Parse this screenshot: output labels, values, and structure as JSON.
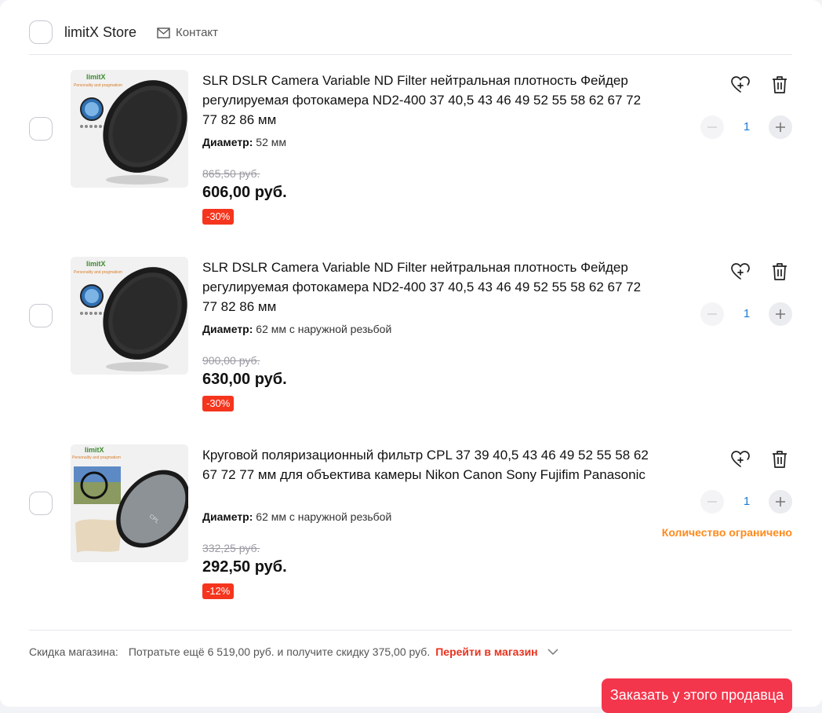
{
  "store": {
    "name": "limitX Store",
    "contact_label": "Контакт"
  },
  "items": [
    {
      "title": "SLR DSLR Camera Variable ND Filter нейтральная плотность Фейдер регулируемая фотокамера ND2-400 37 40,5 43 46 49 52 55 58 62 67 72 77 82 86 мм",
      "spec_label": "Диаметр:",
      "spec_value": "52 мм",
      "old_price": "865,50 руб.",
      "price": "606,00 руб.",
      "discount": "-30%",
      "quantity": "1",
      "limited_note": ""
    },
    {
      "title": "SLR DSLR Camera Variable ND Filter нейтральная плотность Фейдер регулируемая фотокамера ND2-400 37 40,5 43 46 49 52 55 58 62 67 72 77 82 86 мм",
      "spec_label": "Диаметр:",
      "spec_value": "62 мм с наружной резьбой",
      "old_price": "900,00 руб.",
      "price": "630,00 руб.",
      "discount": "-30%",
      "quantity": "1",
      "limited_note": ""
    },
    {
      "title": "Круговой поляризационный фильтр CPL 37 39 40,5 43 46 49 52 55 58 62 67 72 77 мм для объектива камеры Nikon Canon Sony Fujifim Panasonic",
      "spec_label": "Диаметр:",
      "spec_value": "62 мм с наружной резьбой",
      "old_price": "332,25 руб.",
      "price": "292,50 руб.",
      "discount": "-12%",
      "quantity": "1",
      "limited_note": "Количество ограничено"
    }
  ],
  "thumb_text": {
    "brand": "limitX",
    "tagline": "Personality and pragmatism",
    "cpl_mark": "CPL"
  },
  "store_discount": {
    "label": "Скидка магазина:",
    "text": "Потратьте ещё 6 519,00 руб. и получите скидку 375,00 руб.",
    "link": "Перейти в магазин"
  },
  "order_button": "Заказать у этого продавца",
  "colors": {
    "accent_red": "#f4364c",
    "discount_badge": "#f5351d",
    "link_red": "#e8321e",
    "qty_blue": "#1b7bd6",
    "limited_orange": "#ff8a1c"
  },
  "icons": {
    "contact": "mail-icon",
    "wishlist": "heart-plus-icon",
    "delete": "trash-icon",
    "minus": "minus-icon",
    "plus": "plus-icon",
    "expand": "chevron-down-icon"
  }
}
